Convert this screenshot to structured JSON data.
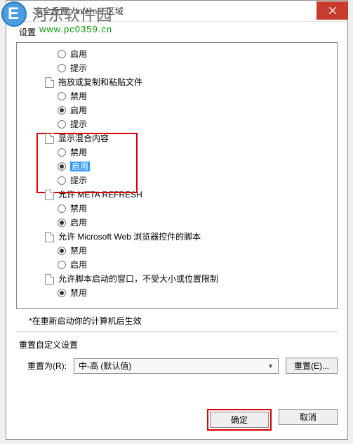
{
  "watermark": {
    "line1": "河东软件园",
    "line2": "www.pc0359.cn"
  },
  "titlebar": {
    "text": "安全设置 - Internet 区域"
  },
  "settings_label": "设置",
  "tree": {
    "items": [
      {
        "type": "radio",
        "label": "启用",
        "checked": false
      },
      {
        "type": "radio",
        "label": "提示",
        "checked": false
      },
      {
        "type": "cat",
        "label": "拖放或复制和粘贴文件"
      },
      {
        "type": "radio",
        "label": "禁用",
        "checked": false
      },
      {
        "type": "radio",
        "label": "启用",
        "checked": true
      },
      {
        "type": "radio",
        "label": "提示",
        "checked": false
      },
      {
        "type": "cat",
        "label": "显示混合内容"
      },
      {
        "type": "radio",
        "label": "禁用",
        "checked": false
      },
      {
        "type": "radio",
        "label": "启用",
        "checked": true,
        "selected": true
      },
      {
        "type": "radio",
        "label": "提示",
        "checked": false
      },
      {
        "type": "cat",
        "label": "允许 META REFRESH"
      },
      {
        "type": "radio",
        "label": "禁用",
        "checked": false
      },
      {
        "type": "radio",
        "label": "启用",
        "checked": true
      },
      {
        "type": "cat",
        "label": "允许 Microsoft Web 浏览器控件的脚本"
      },
      {
        "type": "radio",
        "label": "禁用",
        "checked": true
      },
      {
        "type": "radio",
        "label": "启用",
        "checked": false
      },
      {
        "type": "cat",
        "label": "允许脚本启动的窗口，不受大小或位置限制"
      },
      {
        "type": "radio",
        "label": "禁用",
        "checked": true
      }
    ]
  },
  "note": "*在重新启动你的计算机后生效",
  "reset_section_label": "重置自定义设置",
  "reset_row_label": "重置为(R):",
  "dropdown_value": "中-高 (默认值)",
  "reset_button": "重置(E)...",
  "ok_button": "确定",
  "cancel_button": "取消"
}
